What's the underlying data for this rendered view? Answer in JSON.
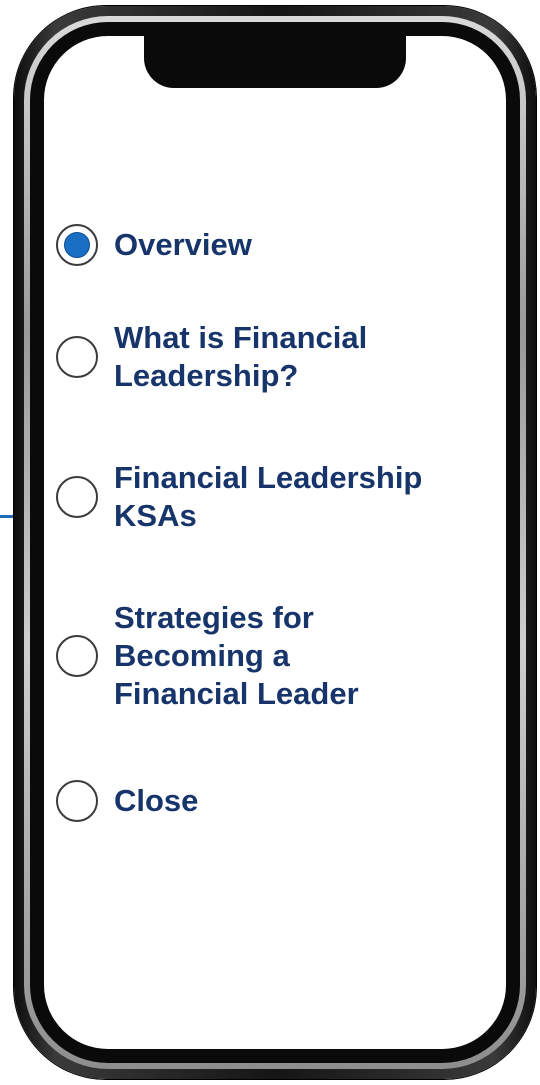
{
  "menu": {
    "items": [
      {
        "label": "Overview",
        "selected": true
      },
      {
        "label": "What is Financial\nLeadership?",
        "selected": false
      },
      {
        "label": "Financial Leadership\nKSAs",
        "selected": false
      },
      {
        "label": "Strategies for\nBecoming a\nFinancial Leader",
        "selected": false
      },
      {
        "label": "Close",
        "selected": false
      }
    ]
  },
  "colors": {
    "accent": "#1a6fc4",
    "label_text": "#17356b",
    "connector": "#1e6bb8"
  }
}
